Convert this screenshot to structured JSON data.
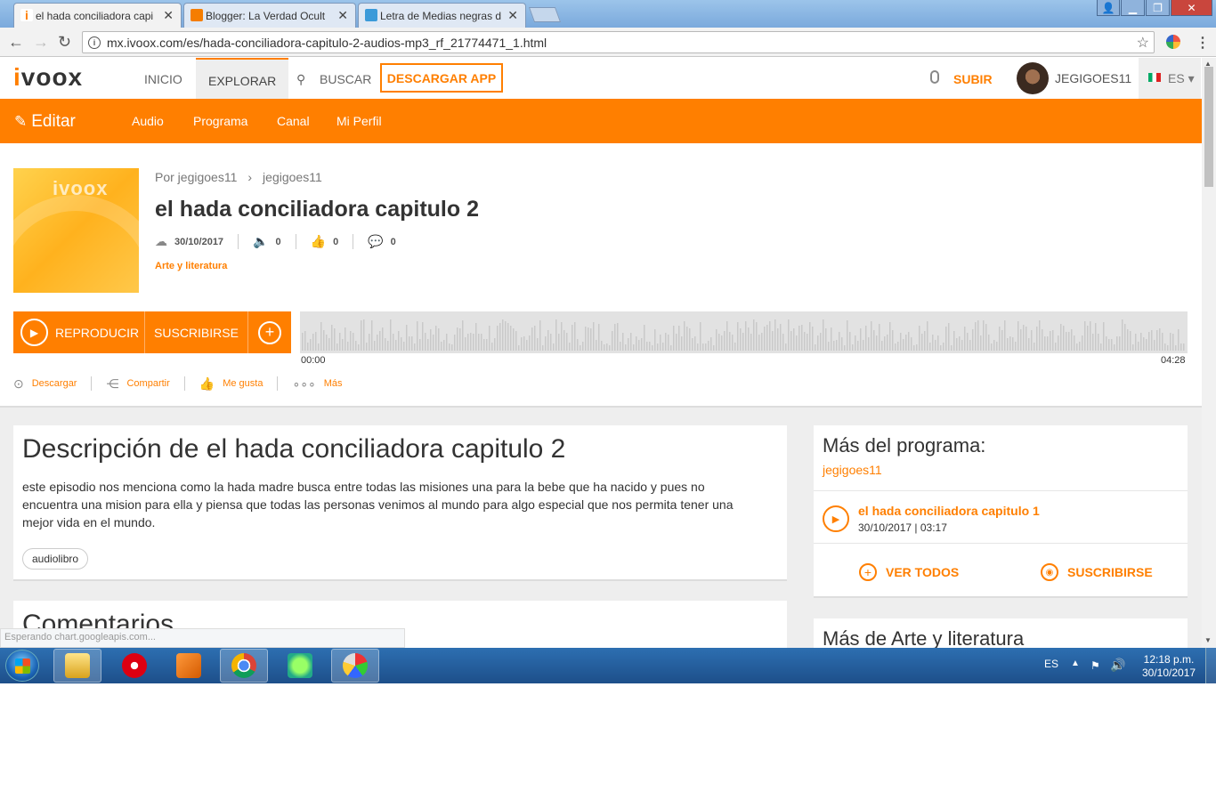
{
  "browser": {
    "tabs": [
      {
        "label": "el hada conciliadora capi",
        "favicon_color": "#ff7f00"
      },
      {
        "label": "Blogger: La Verdad Ocult",
        "favicon_color": "#f57d00"
      },
      {
        "label": "Letra de Medias negras d",
        "favicon_color": "#3b9ad9"
      }
    ],
    "url": "mx.ivoox.com/es/hada-conciliadora-capitulo-2-audios-mp3_rf_21774471_1.html"
  },
  "nav": {
    "logo": "ivoox",
    "items": [
      "INICIO",
      "EXPLORAR",
      "BUSCAR"
    ],
    "download_app": "DESCARGAR APP",
    "upload": "SUBIR",
    "username": "JEGIGOES11",
    "language": "ES"
  },
  "editbar": {
    "edit_label": "Editar",
    "items": [
      "Audio",
      "Programa",
      "Canal",
      "Mi Perfil"
    ]
  },
  "episode": {
    "cover_text": "ivoox",
    "breadcrumb_by": "Por jegigoes11",
    "breadcrumb_channel": "jegigoes11",
    "title": "el hada conciliadora capitulo 2",
    "date": "30/10/2017",
    "plays": "0",
    "likes": "0",
    "comments": "0",
    "category": "Arte y literatura",
    "play_label": "REPRODUCIR",
    "subscribe_label": "SUSCRIBIRSE",
    "time_start": "00:00",
    "time_end": "04:28",
    "actions": [
      "Descargar",
      "Compartir",
      "Me gusta",
      "Más"
    ]
  },
  "description": {
    "title": "Descripción de el hada conciliadora capitulo 2",
    "text": "este episodio nos menciona como la hada madre busca entre todas las misiones una para la bebe que ha nacido y pues no encuentra una mision para ella y piensa que todas las personas venimos al mundo para algo especial que nos permita tener una mejor vida en el mundo.",
    "tag": "audiolibro"
  },
  "comments": {
    "title": "Comentarios"
  },
  "sidebar": {
    "title": "Más del programa:",
    "program": "jegigoes11",
    "episode_title": "el hada conciliadora capitulo 1",
    "episode_meta": "30/10/2017 | 03:17",
    "view_all": "VER TODOS",
    "subscribe": "SUSCRIBIRSE",
    "more_title": "Más de Arte y literatura"
  },
  "status_text": "Esperando chart.googleapis.com...",
  "taskbar": {
    "lang": "ES",
    "time": "12:18 p.m.",
    "date": "30/10/2017"
  },
  "colors": {
    "accent": "#ff7f00",
    "taskbar": "#2d6fb1"
  }
}
